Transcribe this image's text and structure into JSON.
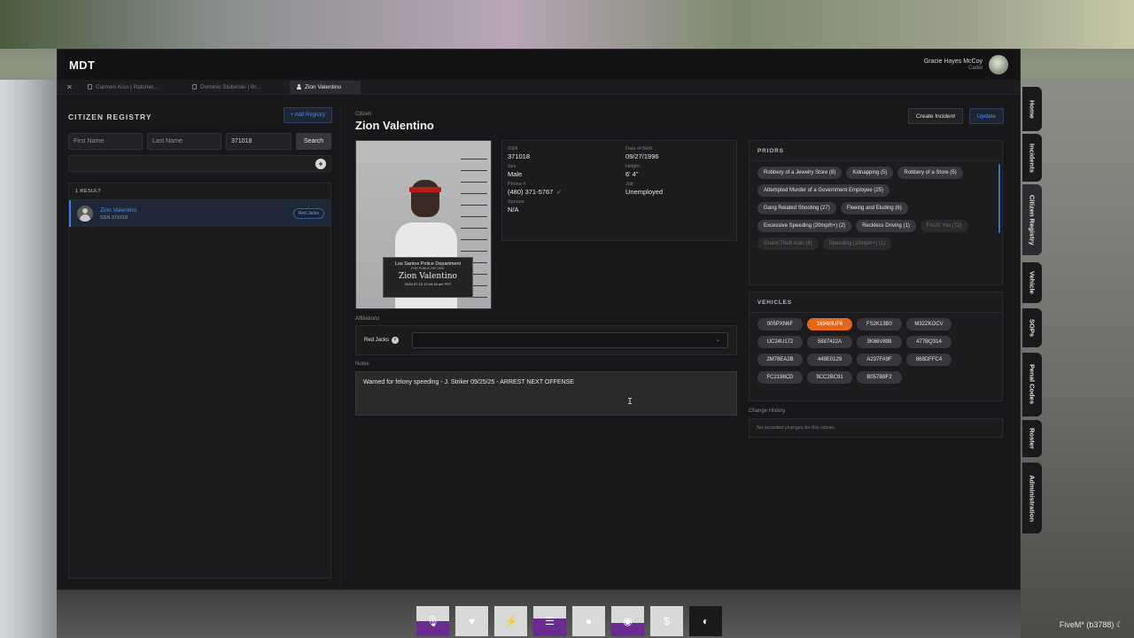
{
  "window": {
    "title": "MDT",
    "user_name": "Gracie Hayes McCoy",
    "user_rank": "Cadet"
  },
  "tabs": [
    {
      "label": "Carmen Kiss | Ratchet..."
    },
    {
      "label": "Dominic Stubinski | Br..."
    },
    {
      "label": "Zion Valentino"
    }
  ],
  "registry": {
    "title": "CITIZEN REGISTRY",
    "add_label": "+ Add Registry",
    "first_name_placeholder": "First Name",
    "last_name_placeholder": "Last Name",
    "search_value": "371018",
    "search_label": "Search",
    "results_count": "1 RESULT",
    "results": [
      {
        "name": "Zion Valentino",
        "ssn": "SSN 371018",
        "badge": "Red Jacks"
      }
    ]
  },
  "citizen": {
    "label": "Citizen",
    "name": "Zion Valentino",
    "mugshot": {
      "dept": "Los Santos Police Department",
      "sub": "FOR PUBLIC RECORD",
      "name": "Zion Valentino",
      "date": "2026-07-15 12:44:16 am PST"
    },
    "info": {
      "ssn_label": "SSN",
      "ssn": "371018",
      "dob_label": "Date of Birth",
      "dob": "09/27/1996",
      "sex_label": "Sex",
      "sex": "Male",
      "height_label": "Height",
      "height": "6' 4\"",
      "phone_label": "Phone #",
      "phone": "(480) 371-5767",
      "job_label": "Job",
      "job": "Unemployed",
      "spouse_label": "Spouse",
      "spouse": "N/A"
    },
    "affiliations_label": "Affiliations",
    "affiliations": [
      "Red Jacks"
    ],
    "notes_label": "Notes",
    "notes": "Warned for felony speeding - J. Striker 09/25/25 - ARREST NEXT OFFENSE"
  },
  "actions": {
    "create_incident": "Create Incident",
    "update": "Update"
  },
  "priors": {
    "title": "PRIORS",
    "items": [
      {
        "label": "Robbery of a Jewelry Store (8)"
      },
      {
        "label": "Kidnapping (5)"
      },
      {
        "label": "Robbery of a Store (5)"
      },
      {
        "label": "Attempted Murder of a Government Employee (25)"
      },
      {
        "label": "Gang Related Shooting (27)"
      },
      {
        "label": "Fleeing and Eluding (6)"
      },
      {
        "label": "Excessive Speeding (20mp/h+) (2)"
      },
      {
        "label": "Reckless Driving (1)"
      },
      {
        "label": "FAUX You (72)"
      },
      {
        "label": "Grand Theft Auto (4)"
      },
      {
        "label": "Speeding (10mp/h+) (1)"
      }
    ]
  },
  "vehicles": {
    "title": "VEHICLES",
    "plates": [
      "005PXN6F",
      "1694MUF6",
      "FS2K13B0",
      "M32ZKOCV",
      "UC24U172",
      "5887422A",
      "3K66V898",
      "477BQ314",
      "2M78EA2B",
      "449E0129",
      "A237FA9F",
      "868DFFC4",
      "FC2198CD",
      "9CC2BC91",
      "B057B8F2"
    ],
    "highlight_color": "#e5671a"
  },
  "change_history": {
    "label": "Change History",
    "empty_text": "No recorded changes for this citizen."
  },
  "side_nav": [
    "Home",
    "Incidents",
    "Citizen Registry",
    "Vehicle",
    "SOPs",
    "Penal Codes",
    "Roster",
    "Administration"
  ],
  "hud_icons": [
    "microphone-icon",
    "heart-icon",
    "lightning-icon",
    "burger-icon",
    "water-drop-icon",
    "pills-icon",
    "dollar-icon",
    "capsule-icon"
  ],
  "overlay": {
    "fivem": "FiveM* (b3788) ☾"
  },
  "colors": {
    "accent": "#4d8df0",
    "panel": "#1c1c1f",
    "window": "#18181a"
  }
}
